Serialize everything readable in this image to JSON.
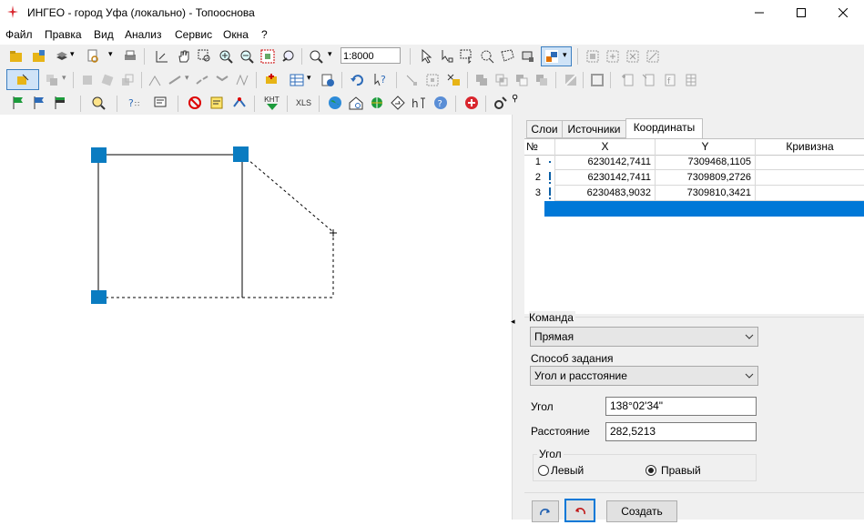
{
  "window": {
    "title": "ИНГЕО - город Уфа (локально) - Топооснова",
    "minimize": "—",
    "maximize": "☐",
    "close": "✕"
  },
  "menu": [
    "Файл",
    "Правка",
    "Вид",
    "Анализ",
    "Сервис",
    "Окна",
    "?"
  ],
  "toolbar": {
    "scale_value": "1:8000",
    "xls_label": "XLS",
    "knt_label": "КНТ"
  },
  "panel": {
    "tabs": [
      "Слои",
      "Источники",
      "Координаты"
    ],
    "active_tab": "Координаты",
    "grid": {
      "columns": [
        "№",
        "X",
        "Y",
        "Кривизна"
      ],
      "rows": [
        {
          "n": "1",
          "x": "6230142,7411",
          "y": "7309468,1105",
          "curv": ""
        },
        {
          "n": "2",
          "x": "6230142,7411",
          "y": "7309809,2726",
          "curv": ""
        },
        {
          "n": "3",
          "x": "6230483,9032",
          "y": "7309810,3421",
          "curv": ""
        }
      ]
    },
    "command_label": "Команда",
    "command_value": "Прямая",
    "method_label": "Способ задания",
    "method_value": "Угол и расстояние",
    "angle_label": "Угол",
    "angle_value": "138°02'34\"",
    "distance_label": "Расстояние",
    "distance_value": "282,5213",
    "angle_group_label": "Угол",
    "radio_left": "Левый",
    "radio_right": "Правый",
    "radio_selected": "Правый",
    "create_button": "Создать"
  },
  "colors": {
    "vertex": "#0a7cc1",
    "selection": "#0078d7",
    "toolbar_bg": "#f0f0f0",
    "app_icon": "#d9262e"
  }
}
